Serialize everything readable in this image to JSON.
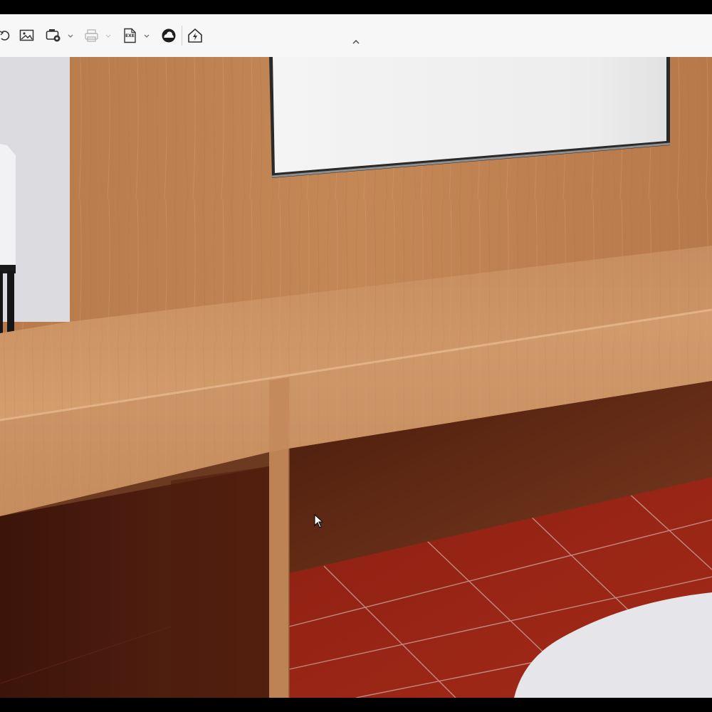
{
  "toolbar": {
    "items": [
      {
        "icon": "undo-redo-icon"
      },
      {
        "icon": "image-icon"
      },
      {
        "icon": "render-settings-icon",
        "dropdown": true
      },
      {
        "icon": "print-icon",
        "dropdown": true,
        "disabled": true
      },
      {
        "icon": "export-exe-icon",
        "label": "EXE",
        "dropdown": true
      },
      {
        "icon": "cloud-icon"
      },
      {
        "icon": "house-lightning-icon"
      }
    ],
    "collapse_icon": "chevron-up-icon"
  },
  "viewport": {
    "scene": "3d-render-interior-wooden-desk",
    "colors": {
      "wood": "#c58a5c",
      "wood_dark": "#a86d44",
      "floor_tile": "#8a1e14",
      "grout": "#c9a29a",
      "screen": "#f2f2f2",
      "wall_panel": "#dcdce0"
    }
  }
}
